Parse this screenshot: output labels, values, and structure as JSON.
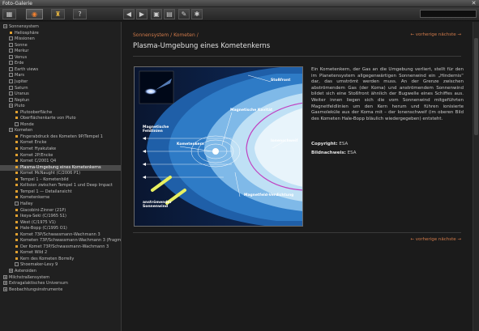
{
  "window": {
    "title": "Foto-Galerie",
    "close_glyph": "✕"
  },
  "toolbar": {
    "buttons": [
      {
        "icon": "grid-icon",
        "glyph": "▦"
      },
      {
        "icon": "camera-icon",
        "glyph": "◉"
      },
      {
        "icon": "trophy-icon",
        "glyph": "♜"
      },
      {
        "icon": "help-icon",
        "glyph": "?"
      },
      {
        "icon": "back-icon",
        "glyph": "◀"
      },
      {
        "icon": "forward-icon",
        "glyph": "▶"
      },
      {
        "icon": "save-icon",
        "glyph": "▣"
      },
      {
        "icon": "print-icon",
        "glyph": "▤"
      },
      {
        "icon": "tools-icon",
        "glyph": "✎"
      },
      {
        "icon": "settings-icon",
        "glyph": "✱"
      }
    ],
    "search_placeholder": ""
  },
  "sidebar": {
    "items": [
      {
        "label": "Sonnensystem",
        "type": "box",
        "glyph": "−",
        "indent": 0
      },
      {
        "label": "Heliosphäre",
        "type": "bullet",
        "color": "#e0a030",
        "indent": 1
      },
      {
        "label": "Missionen",
        "type": "box",
        "glyph": "",
        "indent": 1
      },
      {
        "label": "Sonne",
        "type": "box",
        "glyph": "",
        "indent": 1
      },
      {
        "label": "Merkur",
        "type": "box",
        "glyph": "",
        "indent": 1
      },
      {
        "label": "Venus",
        "type": "box",
        "glyph": "",
        "indent": 1
      },
      {
        "label": "Erde",
        "type": "box",
        "glyph": "",
        "indent": 1
      },
      {
        "label": "Earth views",
        "type": "box",
        "glyph": "",
        "indent": 1
      },
      {
        "label": "Mars",
        "type": "box",
        "glyph": "",
        "indent": 1
      },
      {
        "label": "Jupiter",
        "type": "box",
        "glyph": "",
        "indent": 1
      },
      {
        "label": "Saturn",
        "type": "box",
        "glyph": "",
        "indent": 1
      },
      {
        "label": "Uranus",
        "type": "box",
        "glyph": "",
        "indent": 1
      },
      {
        "label": "Neptun",
        "type": "box",
        "glyph": "",
        "indent": 1
      },
      {
        "label": "Pluto",
        "type": "box",
        "glyph": "−",
        "indent": 1
      },
      {
        "label": "Plutooberfläche",
        "type": "bullet",
        "color": "#e0a030",
        "indent": 2
      },
      {
        "label": "Oberflächenkarte von Pluto",
        "type": "bullet",
        "color": "#e0a030",
        "indent": 2
      },
      {
        "label": "Monde",
        "type": "box",
        "glyph": "",
        "indent": 2
      },
      {
        "label": "Kometen",
        "type": "box",
        "glyph": "−",
        "indent": 1
      },
      {
        "label": "Fingerabdruck des Kometen 9P/Tempel 1",
        "type": "bullet",
        "color": "#e0a030",
        "indent": 2
      },
      {
        "label": "Komet Encke",
        "type": "bullet",
        "color": "#e0a030",
        "indent": 2
      },
      {
        "label": "Komet Hyakutake",
        "type": "bullet",
        "color": "#e0a030",
        "indent": 2
      },
      {
        "label": "Komet 2P/Encke",
        "type": "bullet",
        "color": "#e0a030",
        "indent": 2
      },
      {
        "label": "Komet C/2001 Q4",
        "type": "bullet",
        "color": "#e0a030",
        "indent": 2
      },
      {
        "label": "Plasma-Umgebung eines Kometenkerns",
        "type": "bullet",
        "color": "#e0a030",
        "indent": 2,
        "selected": true
      },
      {
        "label": "Komet McNaught (C/2006 P1)",
        "type": "bullet",
        "color": "#e0a030",
        "indent": 2
      },
      {
        "label": "Tempel 1 – Kometenbild",
        "type": "bullet",
        "color": "#e0a030",
        "indent": 2
      },
      {
        "label": "Kollision zwischen Tempel 1 und Deep Impact",
        "type": "bullet",
        "color": "#e0a030",
        "indent": 2
      },
      {
        "label": "Tempel 1 — Detailansicht",
        "type": "bullet",
        "color": "#e0a030",
        "indent": 2
      },
      {
        "label": "Kometenkerne",
        "type": "bullet",
        "color": "#e0a030",
        "indent": 2
      },
      {
        "label": "Halley",
        "type": "box",
        "glyph": "",
        "indent": 2
      },
      {
        "label": "Giacobini-Zinner (21P)",
        "type": "bullet",
        "color": "#e0a030",
        "indent": 2
      },
      {
        "label": "Ikeya-Seki (C/1965 S1)",
        "type": "bullet",
        "color": "#e0a030",
        "indent": 2
      },
      {
        "label": "West (C/1975 V1)",
        "type": "bullet",
        "color": "#e0a030",
        "indent": 2
      },
      {
        "label": "Hale-Bopp (C/1995 O1)",
        "type": "bullet",
        "color": "#e0a030",
        "indent": 2
      },
      {
        "label": "Komet 73P/Schwassmann-Wachmann 3",
        "type": "bullet",
        "color": "#e0a030",
        "indent": 2
      },
      {
        "label": "Kometen 73P/Schwassmann-Wachmann 3 (Fragm...",
        "type": "bullet",
        "color": "#e0a030",
        "indent": 2
      },
      {
        "label": "Der Komet 73P/Schwassmann-Wachmann 3",
        "type": "bullet",
        "color": "#e0a030",
        "indent": 2
      },
      {
        "label": "Komet Wild 2",
        "type": "bullet",
        "color": "#e0a030",
        "indent": 2
      },
      {
        "label": "Kern des Kometen Borrelly",
        "type": "bullet",
        "color": "#e0a030",
        "indent": 2
      },
      {
        "label": "Shoemaker-Levy 9",
        "type": "box",
        "glyph": "",
        "indent": 2
      },
      {
        "label": "Asteroiden",
        "type": "box",
        "glyph": "+",
        "indent": 1
      },
      {
        "label": "Milchstraßensystem",
        "type": "box",
        "glyph": "+",
        "indent": 0
      },
      {
        "label": "Extragalaktisches Universum",
        "type": "box",
        "glyph": "+",
        "indent": 0
      },
      {
        "label": "Beobachtungsinstrumente",
        "type": "box",
        "glyph": "+",
        "indent": 0
      }
    ]
  },
  "content": {
    "breadcrumb": "Sonnensystem / Kometen /",
    "nav_prev": "← vorherige",
    "nav_next": "nächste →",
    "title": "Plasma-Umgebung eines Kometenkerns",
    "article": "Ein Kometenkern, der Gas an die Umgebung verliert, stellt für den im Planetensystem allgegenwärtigen Sonnenwind ein „Hindernis“ dar, das umströmt werden muss. An der Grenze zwischen abströmendem Gas (der Koma) und anströmendem Sonnenwind bildet sich eine Stoßfront ähnlich der Bugwelle eines Schiffes aus. Weiter innen liegen sich die vom Sonnenwind mitgeführten Magnetfeldlinien um den Kern herum und führen ionisierte Gasmoleküle aus der Koma mit – der Ionenschweif (im oberen Bild des Kometen Hale-Bopp bläulich wiedergegeben) entsteht.",
    "copyright_label": "Copyright:",
    "copyright_value": "ESA",
    "credit_label": "Bildnachweis:",
    "credit_value": "ESA"
  },
  "figure": {
    "labels": {
      "stossfront": "Stoßfront",
      "kavitaet": "Magnetische Kavität",
      "feldlinien": "Magnetische\nFeldlinien",
      "kometenkern": "Kometenkern",
      "ionenschweif": "Ionenschweif",
      "sonnenwind": "anströmender\nSonnenwind",
      "verdichtung": "Magnetfeld-Verdichtung"
    }
  }
}
